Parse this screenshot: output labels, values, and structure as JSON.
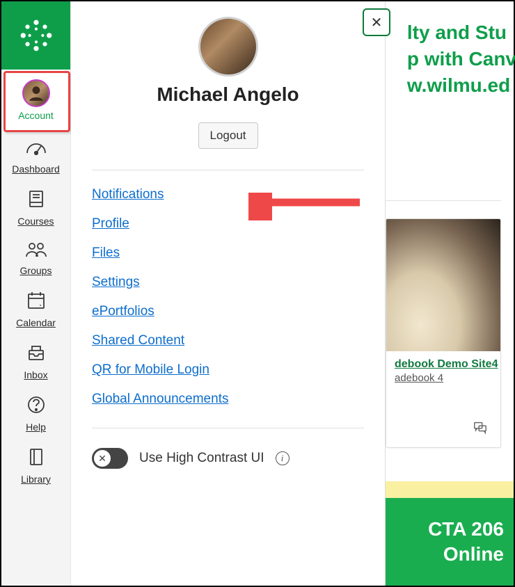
{
  "nav": {
    "account": "Account",
    "dashboard": "Dashboard",
    "courses": "Courses",
    "groups": "Groups",
    "calendar": "Calendar",
    "inbox": "Inbox",
    "help": "Help",
    "library": "Library"
  },
  "tray": {
    "user_name": "Michael Angelo",
    "logout": "Logout",
    "links": {
      "notifications": "Notifications",
      "profile": "Profile",
      "files": "Files",
      "settings": "Settings",
      "eportfolios": "ePortfolios",
      "shared_content": "Shared Content",
      "qr_mobile": "QR for Mobile Login",
      "global_announcements": "Global Announcements"
    },
    "high_contrast_label": "Use High Contrast UI"
  },
  "bg": {
    "banner_line1": "lty and Stu",
    "banner_line2": "p with Canv",
    "banner_line3": "w.wilmu.ed",
    "course_title": "debook Demo Site4",
    "course_sub": "adebook 4",
    "cta_line1": "CTA 206",
    "cta_line2": "Online"
  }
}
